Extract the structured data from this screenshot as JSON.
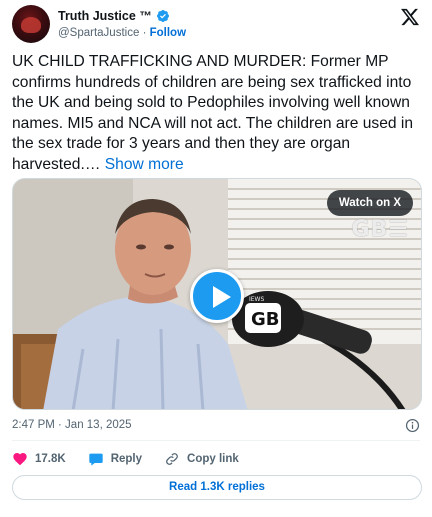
{
  "author": {
    "name": "Truth Justice ™",
    "handle": "@SpartaJustice",
    "separator": "·",
    "follow_label": "Follow"
  },
  "tweet": {
    "text": "UK CHILD TRAFFICKING AND MURDER: Former MP confirms hundreds of children are being sex trafficked into the UK and being sold to Pedophiles involving well known names. MI5 and NCA will not act. The children are used in the sex trade for 3 years and then they are organ harvested.… ",
    "show_more": "Show more",
    "timestamp": "2:47 PM · Jan 13, 2025"
  },
  "media": {
    "watch_label": "Watch on X",
    "watermark": "GB☰",
    "mic_logo_text": "GB",
    "mic_small_text": "IEWS"
  },
  "actions": {
    "likes": "17.8K",
    "reply_label": "Reply",
    "copy_label": "Copy link"
  },
  "replies_button": "Read 1.3K replies",
  "colors": {
    "accent": "#1d9bf0",
    "link": "#006fd6",
    "like": "#f91880",
    "muted": "#536471"
  },
  "icons": [
    "verified-badge-icon",
    "x-logo-icon",
    "play-icon",
    "info-icon",
    "heart-icon",
    "reply-bubble-icon",
    "link-icon"
  ]
}
